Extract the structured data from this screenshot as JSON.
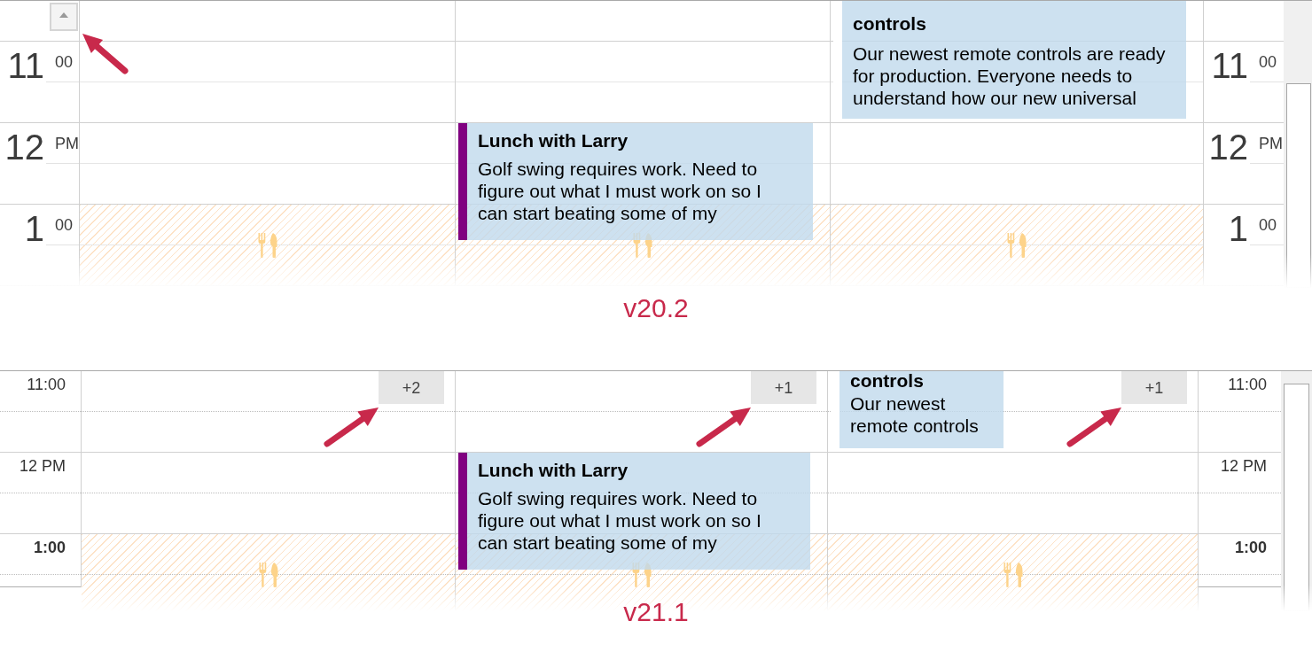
{
  "panels": [
    {
      "kind": "classic",
      "caption": "v20.2",
      "scroll_up_button": {
        "annotated": true
      },
      "rows": [
        {
          "left": {
            "hour": "11",
            "suffix": "00"
          },
          "right": {
            "hour": "11",
            "suffix": "00"
          },
          "cells": [
            {
              "lunch_break": false
            },
            {
              "lunch_break": false
            },
            {
              "lunch_break": false,
              "event": {
                "title": "controls",
                "description": "Our newest remote controls are ready for production. Everyone needs to understand how our new universal",
                "color": "#ffffff",
                "continued": true
              }
            }
          ]
        },
        {
          "left": {
            "hour": "12",
            "suffix": "PM"
          },
          "right": {
            "hour": "12",
            "suffix": "PM"
          },
          "cells": [
            {
              "lunch_break": false
            },
            {
              "lunch_break": false,
              "event": {
                "title": "Lunch with Larry",
                "description": "Golf swing requires work. Need to figure out what I must work on so I can start beating some of my",
                "color": "#800080",
                "continued": false
              }
            },
            {
              "lunch_break": false
            }
          ]
        },
        {
          "left": {
            "hour": "1",
            "suffix": "00"
          },
          "right": {
            "hour": "1",
            "suffix": "00"
          },
          "cells": [
            {
              "lunch_break": true
            },
            {
              "lunch_break": true
            },
            {
              "lunch_break": true
            }
          ]
        }
      ]
    },
    {
      "kind": "compact",
      "caption": "v21.1",
      "rows": [
        {
          "left": {
            "label": "11:00",
            "bold": false
          },
          "right": {
            "label": "11:00",
            "bold": false
          },
          "cells": [
            {
              "lunch_break": false,
              "more_button": {
                "label": "+2",
                "annotated": true
              }
            },
            {
              "lunch_break": false,
              "more_button": {
                "label": "+1",
                "annotated": true
              }
            },
            {
              "lunch_break": false,
              "event": {
                "title": "controls",
                "description": "Our newest remote controls",
                "color": "#ffffff",
                "continued": true
              },
              "more_button": {
                "label": "+1",
                "annotated": true
              }
            }
          ]
        },
        {
          "left": {
            "label": "12 PM",
            "bold": false
          },
          "right": {
            "label": "12 PM",
            "bold": false
          },
          "cells": [
            {
              "lunch_break": false
            },
            {
              "lunch_break": false,
              "event": {
                "title": "Lunch with Larry",
                "description": "Golf swing requires work. Need to figure out what I must work on so I can start beating some of my",
                "color": "#800080",
                "continued": false
              }
            },
            {
              "lunch_break": false
            }
          ]
        },
        {
          "left": {
            "label": "1:00",
            "bold": true
          },
          "right": {
            "label": "1:00",
            "bold": true
          },
          "cells": [
            {
              "lunch_break": true
            },
            {
              "lunch_break": true
            },
            {
              "lunch_break": true
            }
          ]
        }
      ]
    }
  ]
}
